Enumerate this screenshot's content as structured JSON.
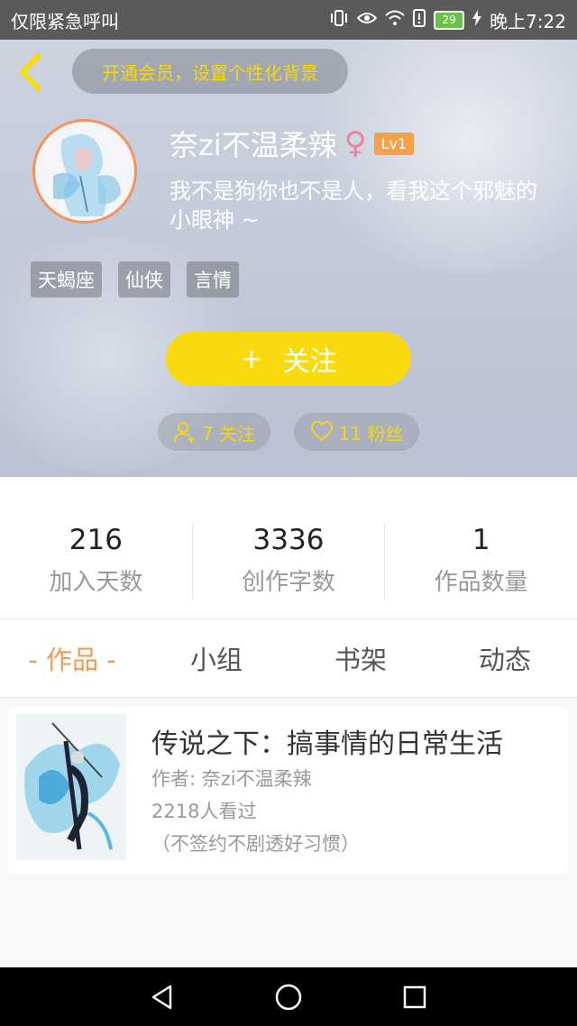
{
  "status_bar": {
    "carrier": "仅限紧急呼叫",
    "battery": "29",
    "time": "晚上7:22",
    "icons": [
      "vibrate-icon",
      "eye-icon",
      "wifi-icon",
      "alert-icon",
      "battery-icon"
    ]
  },
  "header": {
    "vip_banner": "开通会员，设置个性化背景",
    "username": "奈zi不温柔辣",
    "gender_symbol": "♀",
    "level": "Lv1",
    "bio": "我不是狗你也不是人，看我这个邪魅的小眼神 ~",
    "tags": [
      "天蝎座",
      "仙侠",
      "言情"
    ],
    "follow_plus": "+",
    "follow_label": "关注",
    "following_count": "7 关注",
    "fans_count": "11 粉丝"
  },
  "stats": [
    {
      "value": "216",
      "label": "加入天数"
    },
    {
      "value": "3336",
      "label": "创作字数"
    },
    {
      "value": "1",
      "label": "作品数量"
    }
  ],
  "tabs": [
    "- 作品 -",
    "小组",
    "书架",
    "动态"
  ],
  "works": [
    {
      "title": "传说之下：搞事情的日常生活",
      "author": "作者: 奈zi不温柔辣",
      "views": "2218人看过",
      "note": "（不签约不剧透好习惯）"
    }
  ],
  "colors": {
    "accent_yellow": "#f9da0f",
    "tab_active": "#f19a56",
    "level_badge": "#f5a14a",
    "gender_pink": "#f27fa1"
  }
}
